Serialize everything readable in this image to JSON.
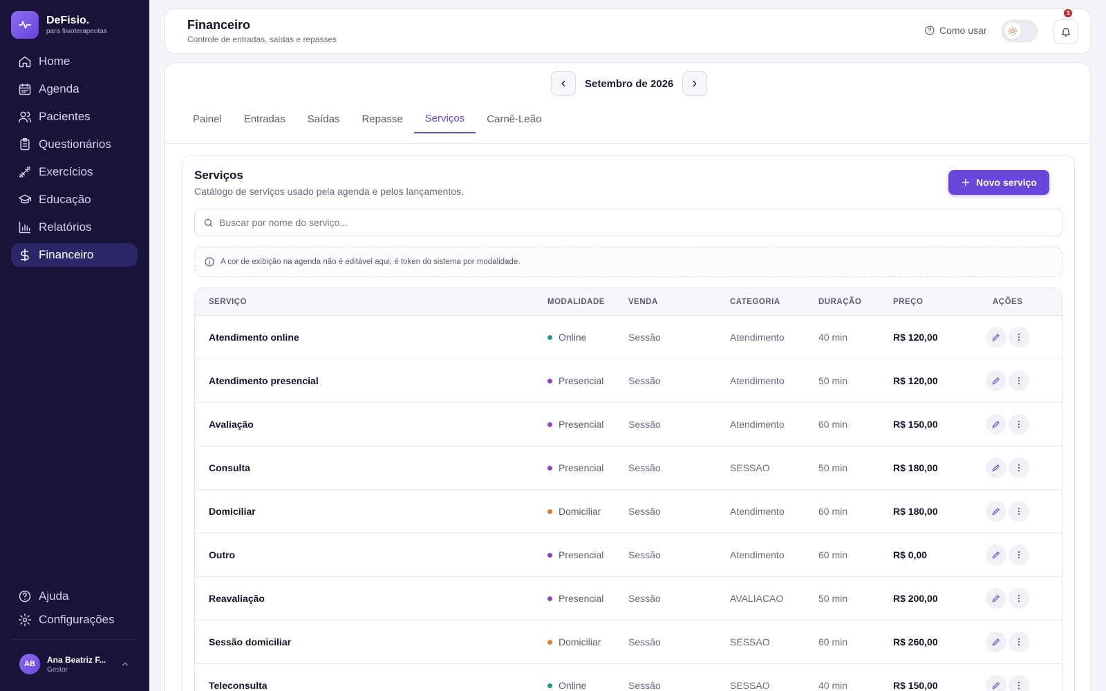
{
  "brand": {
    "name": "DeFisio.",
    "tagline": "para fisioterapeutas"
  },
  "sidebar": {
    "items": [
      {
        "label": "Home",
        "icon": "home-icon"
      },
      {
        "label": "Agenda",
        "icon": "calendar-icon"
      },
      {
        "label": "Pacientes",
        "icon": "users-icon"
      },
      {
        "label": "Questionários",
        "icon": "clipboard-icon"
      },
      {
        "label": "Exercícios",
        "icon": "dumbbell-icon"
      },
      {
        "label": "Educação",
        "icon": "graduation-cap-icon"
      },
      {
        "label": "Relatórios",
        "icon": "bar-chart-icon"
      },
      {
        "label": "Financeiro",
        "icon": "dollar-icon",
        "active": true
      }
    ],
    "bottom": [
      {
        "label": "Ajuda",
        "icon": "help-circle-icon"
      },
      {
        "label": "Configurações",
        "icon": "gear-icon"
      }
    ],
    "user": {
      "initials": "AB",
      "name": "Ana Beatriz F...",
      "role": "Gestor"
    }
  },
  "header": {
    "title": "Financeiro",
    "subtitle": "Controle de entradas, saídas e repasses",
    "help_label": "Como usar",
    "notifications_count": "3"
  },
  "period": {
    "label": "Setembro de 2026"
  },
  "tabs": [
    {
      "label": "Painel"
    },
    {
      "label": "Entradas"
    },
    {
      "label": "Saídas"
    },
    {
      "label": "Repasse"
    },
    {
      "label": "Serviços",
      "active": true
    },
    {
      "label": "Carnê-Leão"
    }
  ],
  "services": {
    "title": "Serviços",
    "subtitle": "Catálogo de serviços usado pela agenda e pelos lançamentos.",
    "new_button": "Novo serviço",
    "search_placeholder": "Buscar por nome do serviço...",
    "info": "A cor de exibição na agenda não é editável aqui, é token do sistema por modalidade.",
    "columns": [
      "SERVIÇO",
      "MODALIDADE",
      "VENDA",
      "CATEGORIA",
      "DURAÇÃO",
      "PREÇO",
      "AÇÕES"
    ],
    "modality_colors": {
      "Online": "#1f9a8f",
      "Presencial": "#9a3fc9",
      "Domiciliar": "#e07a2a"
    },
    "rows": [
      {
        "name": "Atendimento online",
        "modality": "Online",
        "sale": "Sessão",
        "category": "Atendimento",
        "duration": "40 min",
        "price": "R$ 120,00"
      },
      {
        "name": "Atendimento presencial",
        "modality": "Presencial",
        "sale": "Sessão",
        "category": "Atendimento",
        "duration": "50 min",
        "price": "R$ 120,00"
      },
      {
        "name": "Avaliação",
        "modality": "Presencial",
        "sale": "Sessão",
        "category": "Atendimento",
        "duration": "60 min",
        "price": "R$ 150,00"
      },
      {
        "name": "Consulta",
        "modality": "Presencial",
        "sale": "Sessão",
        "category": "SESSAO",
        "duration": "50 min",
        "price": "R$ 180,00"
      },
      {
        "name": "Domiciliar",
        "modality": "Domiciliar",
        "sale": "Sessão",
        "category": "Atendimento",
        "duration": "60 min",
        "price": "R$ 180,00"
      },
      {
        "name": "Outro",
        "modality": "Presencial",
        "sale": "Sessão",
        "category": "Atendimento",
        "duration": "60 min",
        "price": "R$ 0,00"
      },
      {
        "name": "Reavaliação",
        "modality": "Presencial",
        "sale": "Sessão",
        "category": "AVALIACAO",
        "duration": "50 min",
        "price": "R$ 200,00"
      },
      {
        "name": "Sessão domiciliar",
        "modality": "Domiciliar",
        "sale": "Sessão",
        "category": "SESSAO",
        "duration": "60 min",
        "price": "R$ 260,00"
      },
      {
        "name": "Teleconsulta",
        "modality": "Online",
        "sale": "Sessão",
        "category": "SESSAO",
        "duration": "40 min",
        "price": "R$ 150,00"
      }
    ]
  }
}
